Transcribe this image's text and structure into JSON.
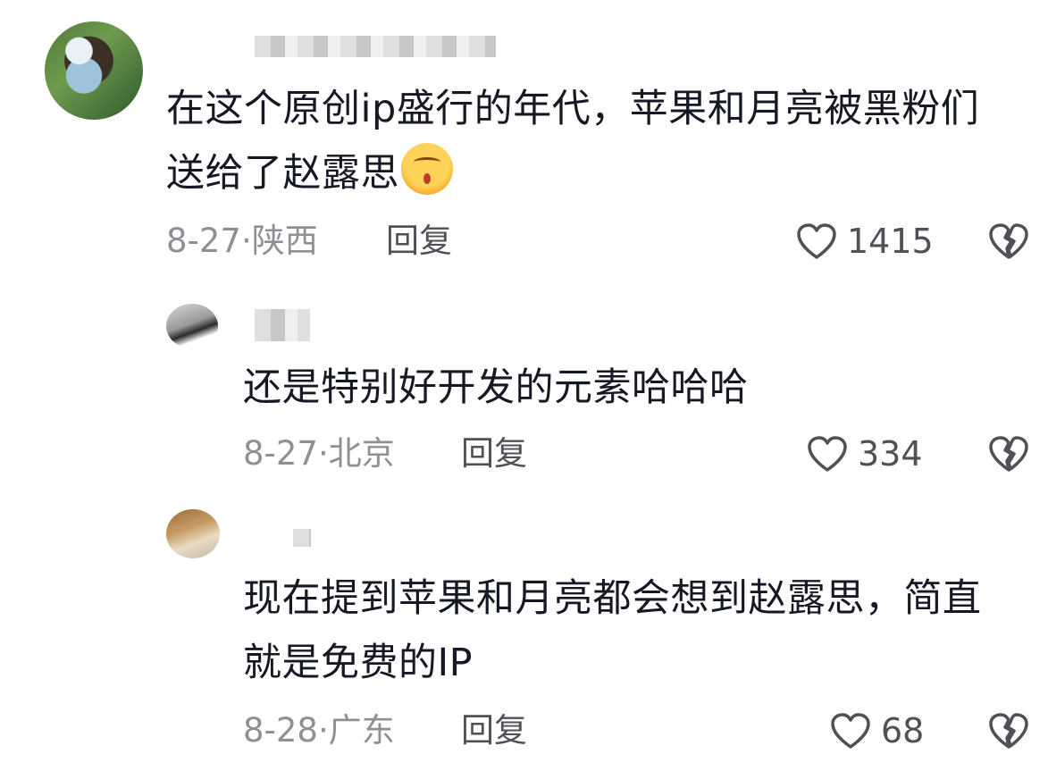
{
  "comments": [
    {
      "text": "在这个原创ip盛行的年代，苹果和月亮被黑粉们\n送给了赵露思",
      "date_location": "8-27·陕西",
      "reply_label": "回复",
      "likes": "1415",
      "emoji_icon": "smirk-face-icon"
    },
    {
      "text": "还是特别好开发的元素哈哈哈",
      "date_location": "8-27·北京",
      "reply_label": "回复",
      "likes": "334"
    },
    {
      "text": "现在提到苹果和月亮都会想到赵露思，简直\n就是免费的IP",
      "date_location": "8-28·广东",
      "reply_label": "回复",
      "likes": "68"
    }
  ],
  "colors": {
    "text": "#161823",
    "meta": "#8f9096",
    "icon": "#505157"
  }
}
